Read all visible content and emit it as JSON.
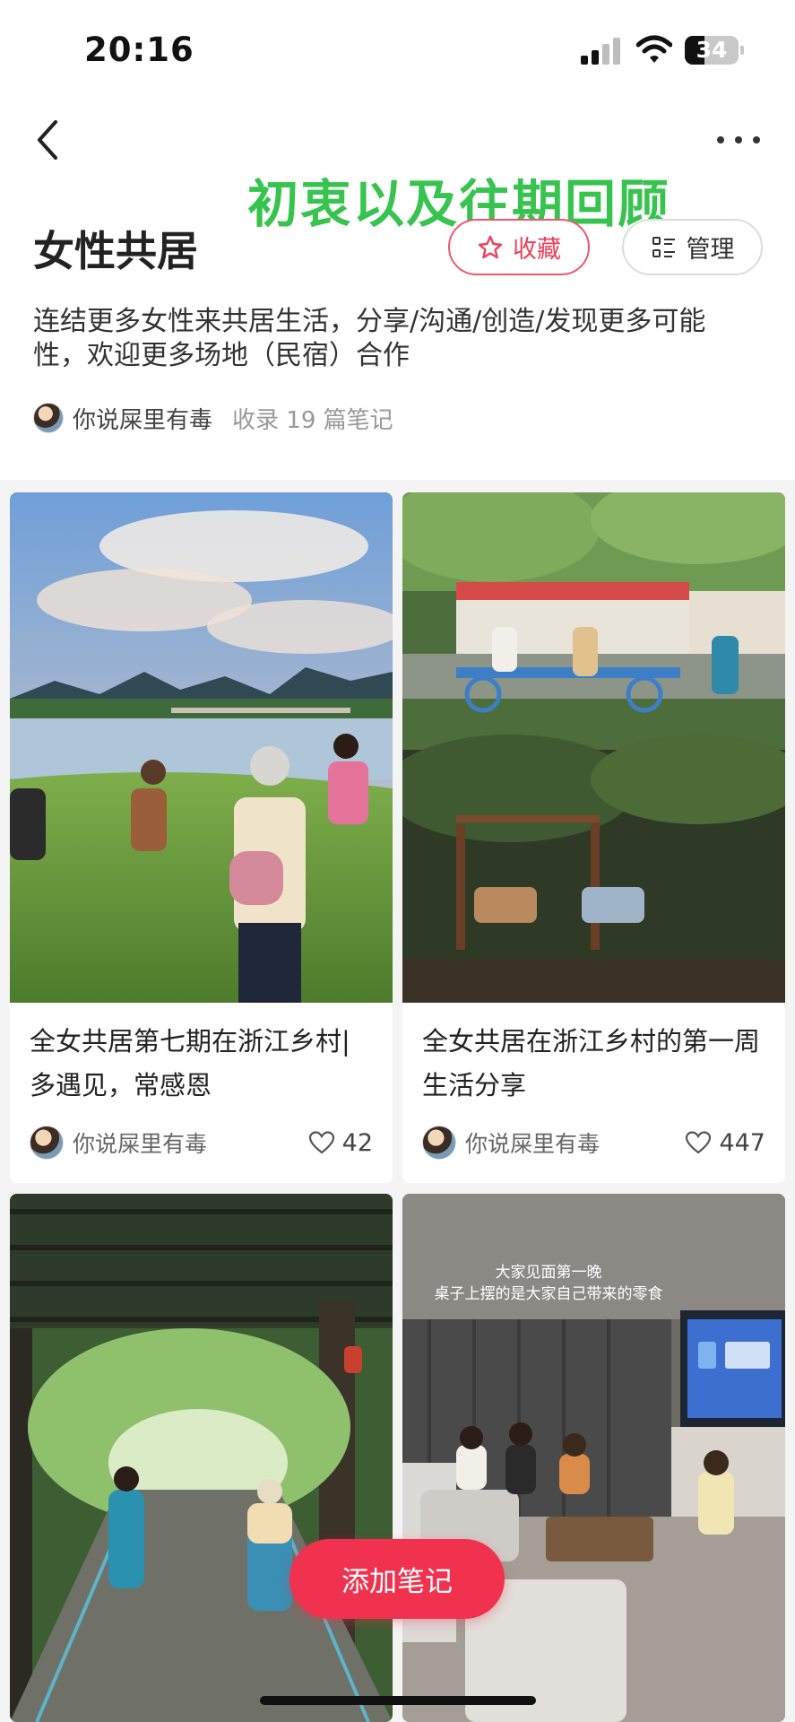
{
  "status_bar": {
    "time": "20:16",
    "battery_level": "34",
    "battery_percent": 34,
    "icons": [
      "signal-icon",
      "wifi-icon",
      "battery-icon"
    ]
  },
  "nav": {
    "back_icon": "chevron-left-icon",
    "more_icon": "more-dots-icon"
  },
  "overlay_text": "初衷以及往期回顾",
  "board": {
    "title": "女性共居",
    "description": "连结更多女性来共居生活，分享/沟通/创造/发现更多可能性，欢迎更多场地（民宿）合作",
    "author": "你说屎里有毒",
    "count_text": "收录 19 篇笔记"
  },
  "actions": {
    "collect_label": "收藏",
    "collect_icon": "star-icon",
    "manage_label": "管理",
    "manage_icon": "list-icon"
  },
  "notes": [
    {
      "title": "全女共居第七期在浙江乡村| 多遇见，常感恩",
      "author": "你说屎里有毒",
      "likes": "42"
    },
    {
      "title": "全女共居在浙江乡村的第一周生活分享",
      "author": "你说屎里有毒",
      "likes": "447"
    },
    {
      "title": "",
      "author": "",
      "likes": ""
    },
    {
      "title": "",
      "author": "",
      "likes": "",
      "image_caption_line1": "大家见面第一晚",
      "image_caption_line2": "桌子上摆的是大家自己带来的零食"
    }
  ],
  "fab": {
    "label": "添加笔记"
  },
  "colors": {
    "accent": "#f0324e",
    "overlay_green": "#36c44e",
    "collect_outline": "#f0576d"
  }
}
